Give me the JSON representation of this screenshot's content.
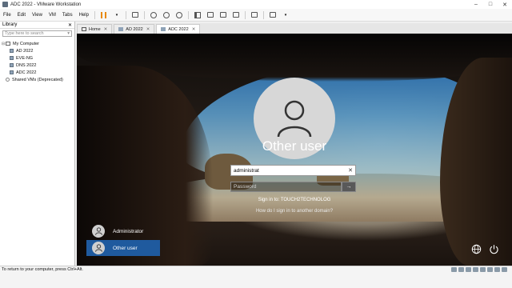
{
  "window": {
    "title": "ADC 2022 - VMware Workstation",
    "controls": [
      "–",
      "□",
      "✕"
    ]
  },
  "menu": {
    "items": [
      "File",
      "Edit",
      "View",
      "VM",
      "Tabs",
      "Help"
    ]
  },
  "library": {
    "title": "Library",
    "close": "✕",
    "search_placeholder": "Type here to search",
    "tree": [
      {
        "label": "My Computer"
      },
      {
        "label": "AD 2022"
      },
      {
        "label": "EVE-NG"
      },
      {
        "label": "DNS 2022"
      },
      {
        "label": "ADC 2022"
      },
      {
        "label": "Shared VMs (Deprecated)"
      }
    ]
  },
  "tabs": [
    {
      "label": "Home",
      "close": "✕"
    },
    {
      "label": "AD 2022",
      "close": "✕"
    },
    {
      "label": "ADC 2022",
      "close": "✕"
    }
  ],
  "login": {
    "user_title": "Other user",
    "username_value": "administrat",
    "username_clear": "✕",
    "password_placeholder": "Password",
    "submit_glyph": "→",
    "sign_in_to": "Sign in to: TOUCH2TECHNOLOG",
    "help_link": "How do I sign in to another domain?",
    "accounts": [
      {
        "label": "Administrator",
        "selected": false
      },
      {
        "label": "Other user",
        "selected": true
      }
    ]
  },
  "status": {
    "text": "To return to your computer, press Ctrl+Alt."
  },
  "colors": {
    "accent": "#1f5a9e",
    "pause": "#e8890c"
  }
}
